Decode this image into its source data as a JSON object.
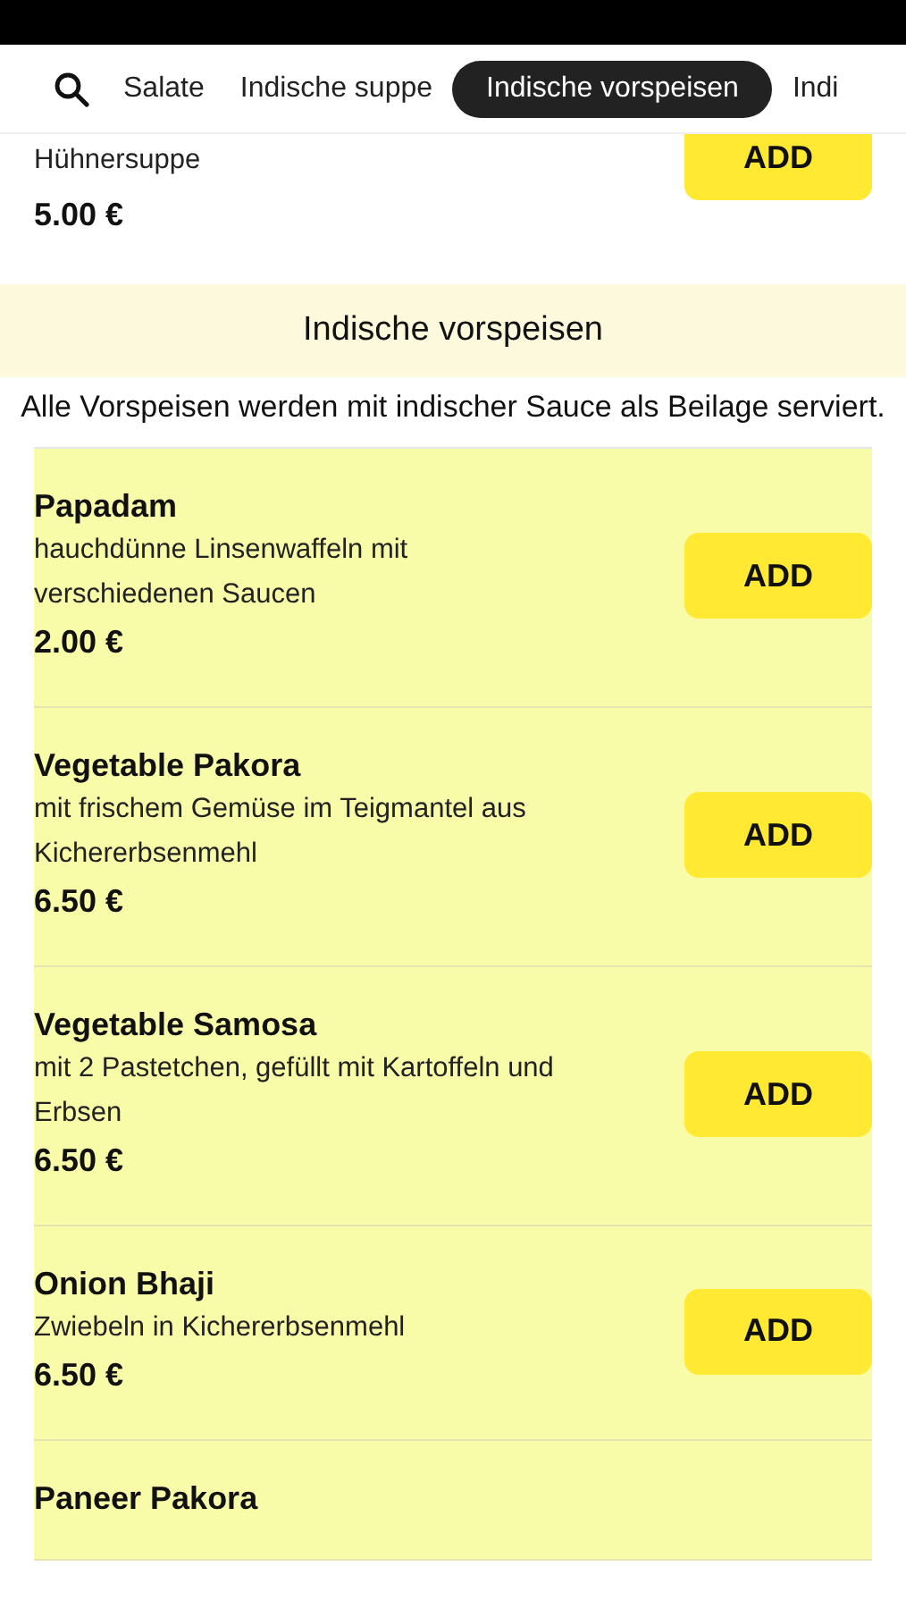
{
  "tabs": [
    {
      "label": "Salate",
      "selected": false
    },
    {
      "label": "Indische suppe",
      "selected": false
    },
    {
      "label": "Indische vorspeisen",
      "selected": true
    },
    {
      "label": "Indi",
      "selected": false
    }
  ],
  "previous_item": {
    "description": "Hühnersuppe",
    "price": "5.00 €",
    "button": "ADD"
  },
  "section": {
    "title": "Indische vorspeisen",
    "note": "Alle Vorspeisen werden mit indischer Sauce als Beilage serviert."
  },
  "items": [
    {
      "name": "Papadam",
      "description": "hauchdünne Linsenwaffeln mit verschiedenen Saucen",
      "price": "2.00 €",
      "button": "ADD"
    },
    {
      "name": "Vegetable Pakora",
      "description": "mit frischem Gemüse im Teigmantel aus Kichererbsenmehl",
      "price": "6.50 €",
      "button": "ADD"
    },
    {
      "name": "Vegetable Samosa",
      "description": "mit 2 Pastetchen, gefüllt mit Kartoffeln und Erbsen",
      "price": "6.50 €",
      "button": "ADD"
    },
    {
      "name": "Onion Bhaji",
      "description": "Zwiebeln in Kichererbsenmehl",
      "price": "6.50 €",
      "button": "ADD"
    },
    {
      "name": "Paneer Pakora"
    }
  ]
}
